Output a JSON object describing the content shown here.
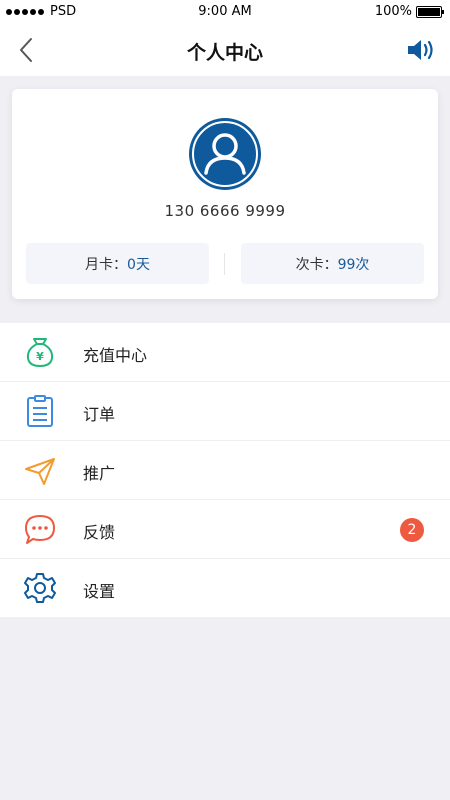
{
  "status_bar": {
    "carrier": "PSD",
    "time": "9:00 AM",
    "battery": "100%"
  },
  "nav": {
    "title": "个人中心",
    "back_icon": "chevron-left-icon",
    "sound_icon": "speaker-icon"
  },
  "profile": {
    "phone": "130 6666 9999",
    "monthly": {
      "label": "月卡：",
      "value": "0天"
    },
    "count": {
      "label": "次卡：",
      "value": "99次"
    }
  },
  "menu": {
    "items": [
      {
        "label": "充值中心",
        "icon": "money-bag-icon"
      },
      {
        "label": "订单",
        "icon": "clipboard-icon"
      },
      {
        "label": "推广",
        "icon": "paper-plane-icon"
      },
      {
        "label": "反馈",
        "icon": "chat-bubble-icon",
        "badge": "2"
      },
      {
        "label": "设置",
        "icon": "gear-icon"
      }
    ]
  },
  "colors": {
    "primary_blue": "#0e5a9c",
    "value_blue": "#1b5b98",
    "green": "#1fb87a",
    "light_blue": "#3d8be0",
    "orange": "#f39b2c",
    "red": "#ee5a3f"
  }
}
